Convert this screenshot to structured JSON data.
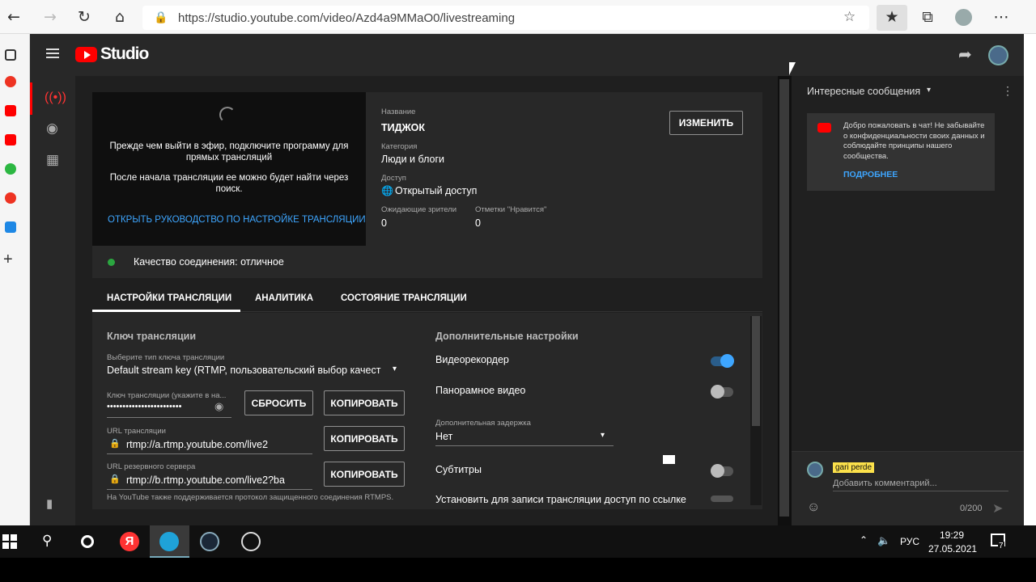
{
  "browser": {
    "url": "https://studio.youtube.com/video/Azd4a9MMaO0/livestreaming"
  },
  "header": {
    "logo_text": "Studio"
  },
  "preview": {
    "line1": "Прежде чем выйти в эфир, подключите программу для прямых трансляций",
    "line2": "После начала трансляции ее можно будет найти через поиск.",
    "guide_link": "ОТКРЫТЬ РУКОВОДСТВО ПО НАСТРОЙКЕ ТРАНСЛЯЦИИ"
  },
  "info": {
    "title_label": "Название",
    "title_value": "ТИДЖОК",
    "edit_button": "ИЗМЕНИТЬ",
    "category_label": "Категория",
    "category_value": "Люди и блоги",
    "access_label": "Доступ",
    "access_value": "Открытый доступ",
    "viewers_label": "Ожидающие зрители",
    "viewers_value": "0",
    "likes_label": "Отметки \"Нравится\"",
    "likes_value": "0"
  },
  "connection": {
    "text": "Качество соединения: отличное",
    "status_color": "#2ba640"
  },
  "tabs": [
    {
      "label": "НАСТРОЙКИ ТРАНСЛЯЦИИ",
      "active": true
    },
    {
      "label": "АНАЛИТИКА",
      "active": false
    },
    {
      "label": "СОСТОЯНИЕ ТРАНСЛЯЦИИ",
      "active": false
    }
  ],
  "stream_key": {
    "section_title": "Ключ трансляции",
    "type_label": "Выберите тип ключа трансляции",
    "type_value": "Default stream key (RTMP, пользовательский выбор качест",
    "key_label": "Ключ трансляции (укажите в на...",
    "key_value": "••••••••••••••••••••••••",
    "reset_button": "СБРОСИТЬ",
    "copy_button": "КОПИРОВАТЬ",
    "url_label": "URL трансляции",
    "url_value": "rtmp://a.rtmp.youtube.com/live2",
    "backup_label": "URL резервного сервера",
    "backup_value": "rtmp://b.rtmp.youtube.com/live2?ba",
    "rtmps_note": "На YouTube также поддерживается протокол защищенного соединения RTMPS."
  },
  "extra": {
    "section_title": "Дополнительные настройки",
    "dvr_label": "Видеорекордер",
    "dvr_on": true,
    "pano_label": "Панорамное видео",
    "pano_on": false,
    "latency_label": "Дополнительная задержка",
    "latency_value": "Нет",
    "subs_label": "Субтитры",
    "subs_on": false,
    "link_access_label": "Установить для записи трансляции доступ по ссылке"
  },
  "chat": {
    "mode_label": "Интересные сообщения",
    "welcome": "Добро пожаловать в чат! Не забывайте о конфиденциальности своих данных и соблюдайте принципы нашего сообщества.",
    "more_link": "ПОДРОБНЕЕ",
    "user_name": "gari perde",
    "input_placeholder": "Добавить комментарий...",
    "char_count": "0/200"
  },
  "taskbar": {
    "lang": "РУС",
    "time": "19:29",
    "date": "27.05.2021",
    "notif_count": "7"
  },
  "colors": {
    "accent_blue": "#3ea6ff",
    "youtube_red": "#ff0000"
  }
}
